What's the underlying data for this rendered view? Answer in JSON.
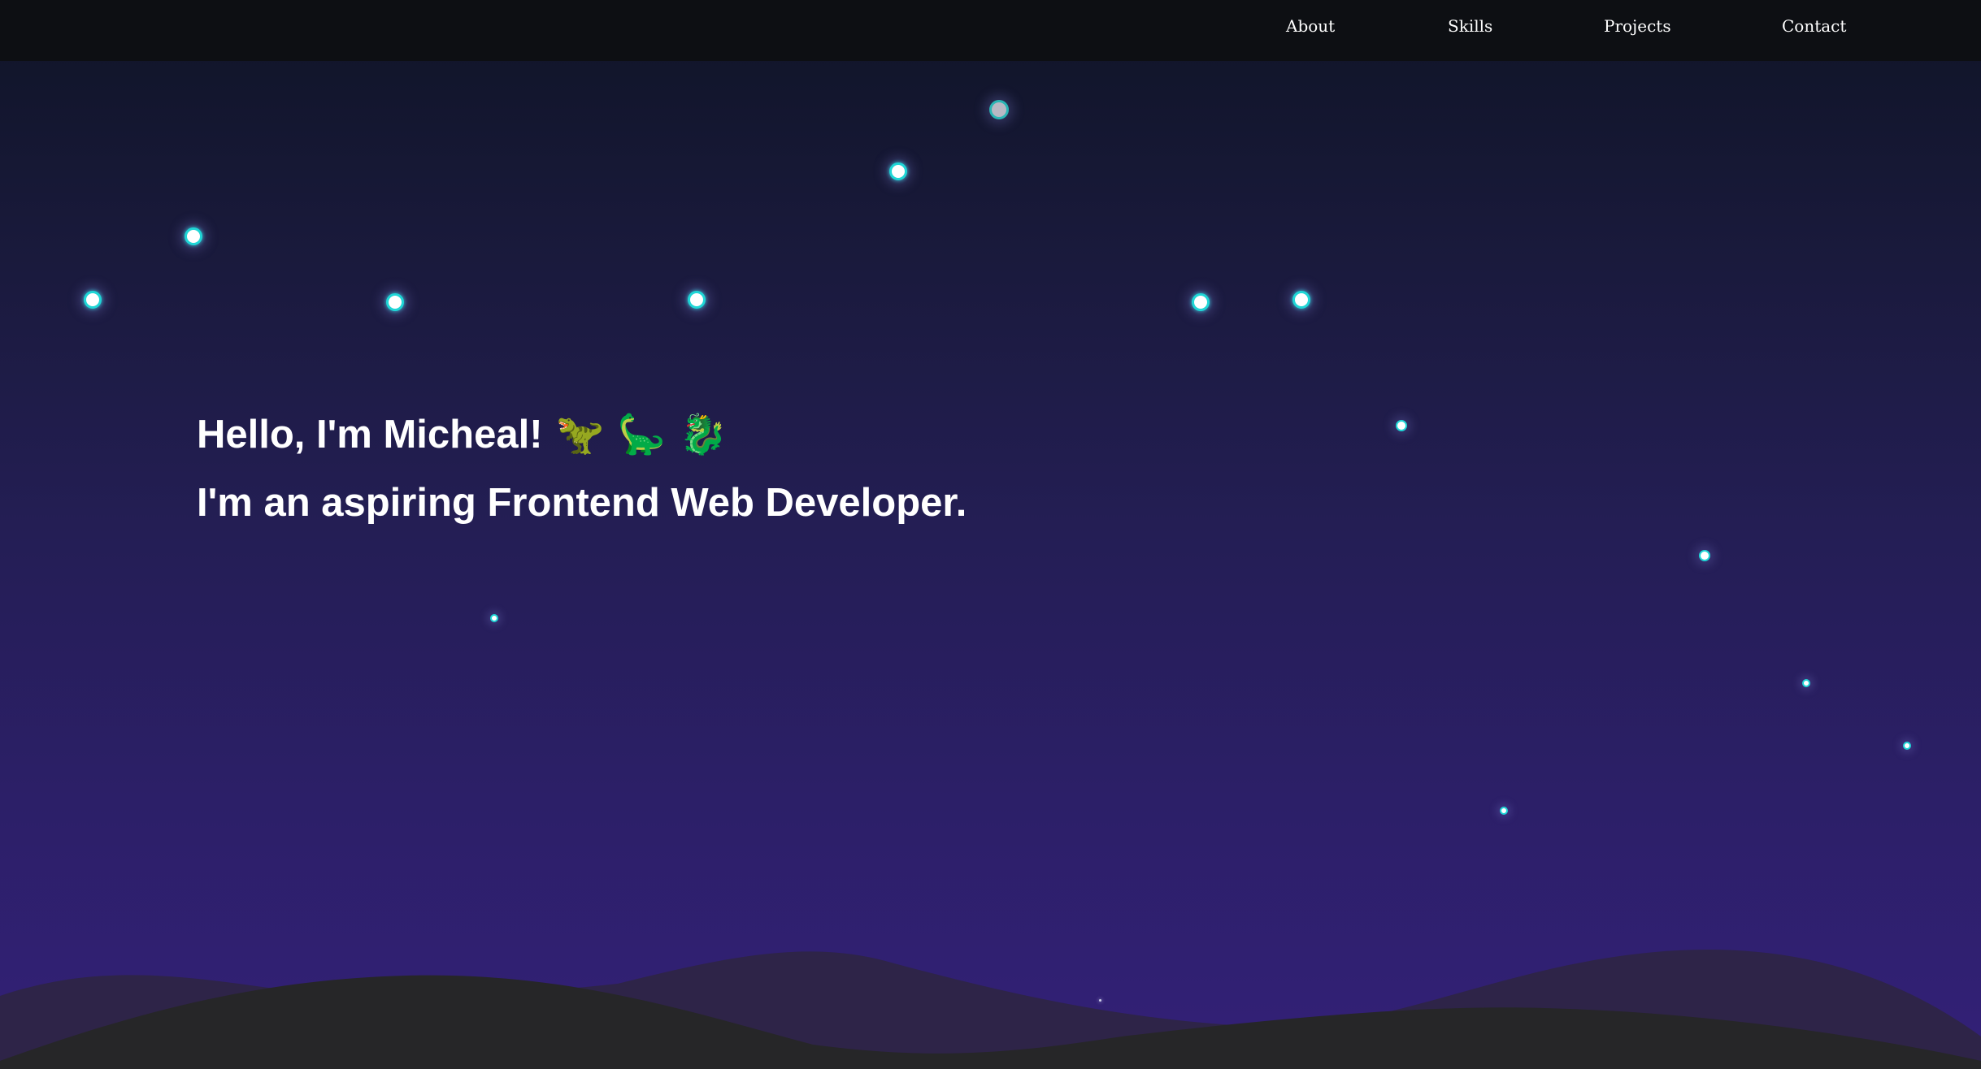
{
  "nav": {
    "items": [
      {
        "label": "About"
      },
      {
        "label": "Skills"
      },
      {
        "label": "Projects"
      },
      {
        "label": "Contact"
      }
    ]
  },
  "hero": {
    "greeting": "Hello, I'm Micheal!",
    "emojis": [
      "🦖",
      "🦕",
      "🐉"
    ],
    "subtitle": "I'm an aspiring Frontend Web Developer."
  },
  "colors": {
    "navbar": "#0d0f13",
    "sky_top": "#0f1426",
    "sky_bottom": "#332078",
    "star_ring": "#1fd6d6",
    "hills_front": "#262628",
    "hills_back": "#2e2448"
  }
}
